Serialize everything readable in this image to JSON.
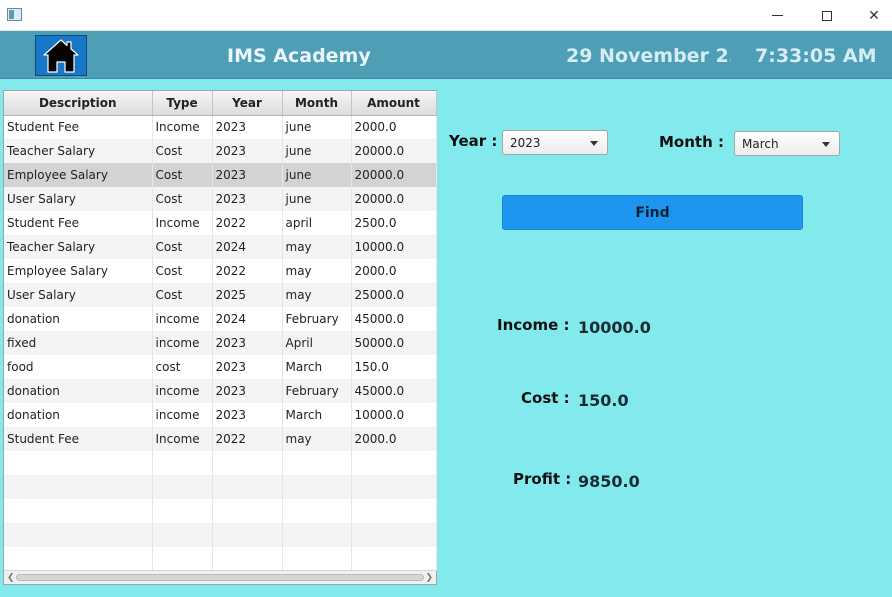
{
  "window": {
    "minimize": "—",
    "maximize": "☐",
    "close": "✕"
  },
  "header": {
    "title": "IMS Academy",
    "date": "29 November 2...",
    "time": "7:33:05 AM",
    "home_icon": "home-icon"
  },
  "table": {
    "columns": [
      "Description",
      "Type",
      "Year",
      "Month",
      "Amount"
    ],
    "rows": [
      [
        "Student Fee",
        "Income",
        "2023",
        "june",
        "2000.0"
      ],
      [
        "Teacher Salary",
        "Cost",
        "2023",
        "june",
        "20000.0"
      ],
      [
        "Employee Salary",
        "Cost",
        "2023",
        "june",
        "20000.0"
      ],
      [
        "User Salary",
        "Cost",
        "2023",
        "june",
        "20000.0"
      ],
      [
        "Student Fee",
        "Income",
        "2022",
        "april",
        "2500.0"
      ],
      [
        "Teacher Salary",
        "Cost",
        "2024",
        "may",
        "10000.0"
      ],
      [
        "Employee Salary",
        "Cost",
        "2022",
        "may",
        "2000.0"
      ],
      [
        "User Salary",
        "Cost",
        "2025",
        "may",
        "25000.0"
      ],
      [
        "donation",
        "income",
        "2024",
        "February",
        "45000.0"
      ],
      [
        "fixed",
        "income",
        "2023",
        "April",
        "50000.0"
      ],
      [
        "food",
        "cost",
        "2023",
        "March",
        "150.0"
      ],
      [
        "donation",
        "income",
        "2023",
        "February",
        "45000.0"
      ],
      [
        "donation",
        "income",
        "2023",
        "March",
        "10000.0"
      ],
      [
        "Student Fee",
        "Income",
        "2022",
        "may",
        "2000.0"
      ]
    ],
    "selected_row": 2
  },
  "filters": {
    "year_label": "Year :",
    "year_value": "2023",
    "month_label": "Month :",
    "month_value": "March",
    "find_label": "Find"
  },
  "summary": {
    "income_label": "Income :",
    "income_value": "10000.0",
    "cost_label": "Cost :",
    "cost_value": "150.0",
    "profit_label": "Profit :",
    "profit_value": "9850.0"
  },
  "colors": {
    "background": "#82e9ec",
    "header": "#4e9eb6",
    "find_button": "#1e96f0",
    "home_button": "#1977c7"
  }
}
